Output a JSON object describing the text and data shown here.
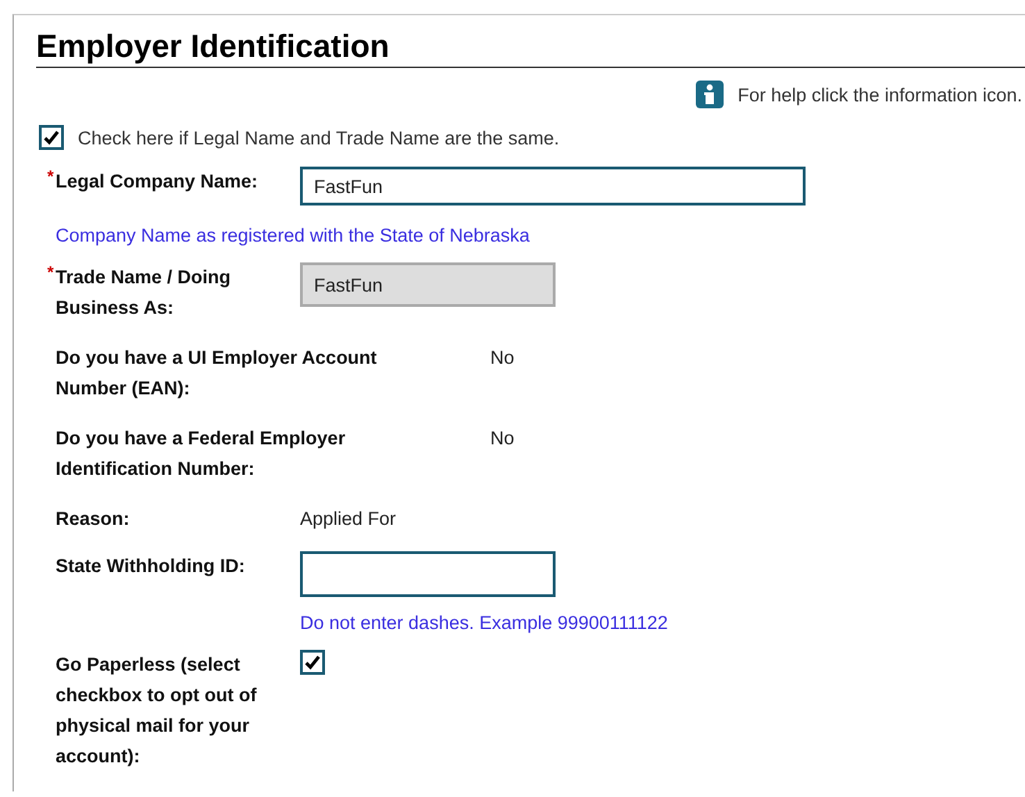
{
  "title": "Employer Identification",
  "help": {
    "text": "For help click the information icon."
  },
  "same_name": {
    "label": "Check here if Legal Name and Trade Name are the same.",
    "checked": true
  },
  "rows": [
    {
      "kind": "input",
      "label": "Legal Company Name:",
      "required_mark": "*",
      "value": "FastFun",
      "disabled": false
    },
    {
      "kind": "note",
      "text": "Company Name as registered with the State of Nebraska"
    },
    {
      "kind": "input",
      "label": "Trade Name / Doing Business As:",
      "required_mark": "*",
      "value": "FastFun",
      "disabled": true
    },
    {
      "kind": "question",
      "label": "Do you have a UI Employer Account Number (EAN):",
      "value": "No"
    },
    {
      "kind": "question",
      "label": "Do you have a Federal Employer Identification Number:",
      "value": "No"
    },
    {
      "kind": "value",
      "label": "Reason:",
      "value": "Applied For"
    },
    {
      "kind": "input",
      "label": "State Withholding ID:",
      "disabled": false,
      "hint": "Do not enter dashes. Example 99900111122"
    },
    {
      "kind": "checkbox",
      "label": "Go Paperless (select checkbox to opt out of physical mail for your account):",
      "checked": true
    }
  ]
}
